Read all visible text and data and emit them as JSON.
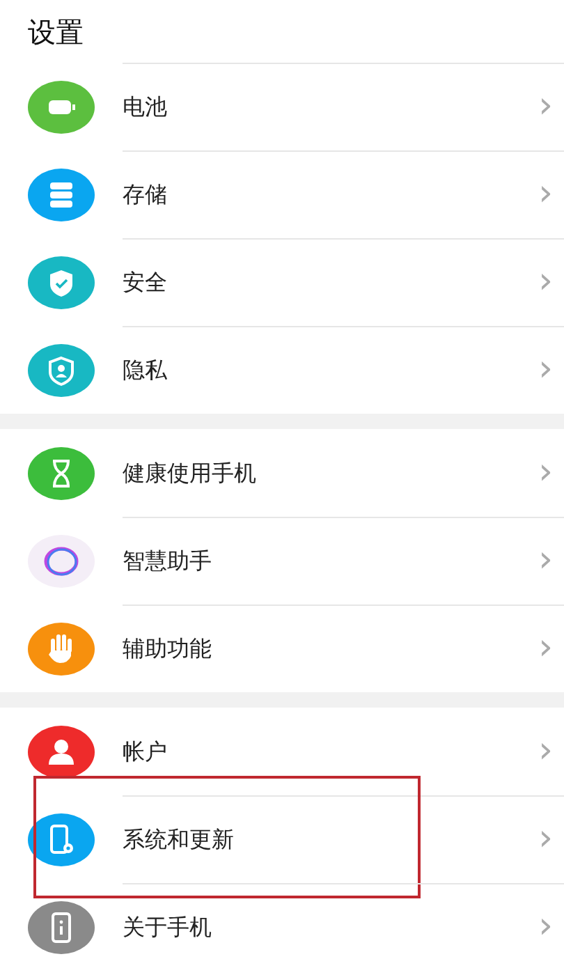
{
  "title": "设置",
  "groups": [
    {
      "items": [
        {
          "label": "电池",
          "chevron": "›",
          "highlighted": false
        },
        {
          "label": "存储",
          "chevron": "›",
          "highlighted": false
        },
        {
          "label": "安全",
          "chevron": "›",
          "highlighted": false
        },
        {
          "label": "隐私",
          "chevron": "›",
          "highlighted": false
        }
      ]
    },
    {
      "items": [
        {
          "label": "健康使用手机",
          "chevron": "›",
          "highlighted": false
        },
        {
          "label": "智慧助手",
          "chevron": "›",
          "highlighted": false
        },
        {
          "label": "辅助功能",
          "chevron": "›",
          "highlighted": false
        }
      ]
    },
    {
      "items": [
        {
          "label": "帐户",
          "chevron": "›",
          "highlighted": false
        },
        {
          "label": "系统和更新",
          "chevron": "›",
          "highlighted": true
        },
        {
          "label": "关于手机",
          "chevron": "›",
          "highlighted": false
        }
      ]
    }
  ]
}
